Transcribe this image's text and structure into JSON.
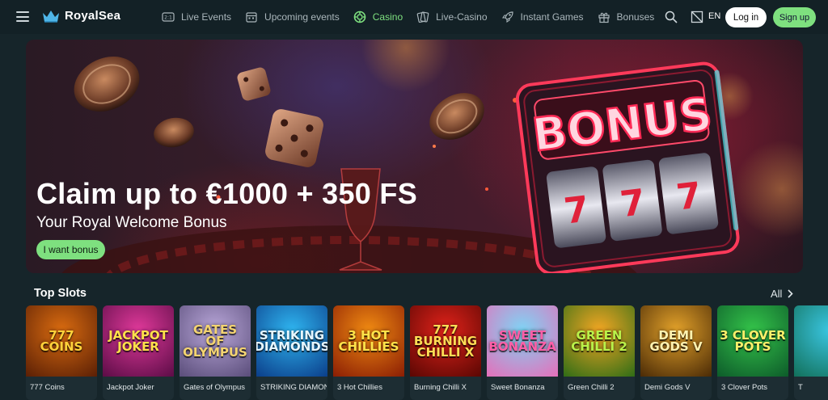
{
  "header": {
    "brand": "RoyalSea",
    "nav": [
      {
        "label": "Live Events",
        "icon": "live-events-icon"
      },
      {
        "label": "Upcoming events",
        "icon": "calendar-icon"
      },
      {
        "label": "Casino",
        "icon": "casino-chip-icon",
        "active": true
      },
      {
        "label": "Live-Casino",
        "icon": "cards-icon"
      },
      {
        "label": "Instant Games",
        "icon": "rocket-icon"
      },
      {
        "label": "Bonuses",
        "icon": "gift-icon"
      }
    ],
    "language": "EN",
    "login_label": "Log in",
    "signup_label": "Sign up",
    "live_events_icon_text": "2:1"
  },
  "banner": {
    "title": "Claim up to €1000 + 350 FS",
    "subtitle": "Your Royal Welcome Bonus",
    "cta_label": "I want bonus",
    "sign_text": "BONUS",
    "reel_symbol": "7"
  },
  "slots_section": {
    "title": "Top Slots",
    "all_label": "All"
  },
  "slots": [
    {
      "name": "777 Coins",
      "art": "777\nCOINS",
      "bg1": "#d96b10",
      "bg2": "#5a1f05",
      "color": "#ffd23a"
    },
    {
      "name": "Jackpot Joker",
      "art": "JACKPOT\nJOKER",
      "bg1": "#e0399a",
      "bg2": "#5b0c46",
      "color": "#ffe14a"
    },
    {
      "name": "Gates of Olympus",
      "art": "GATES OF\nOLYMPUS",
      "bg1": "#b8a6d8",
      "bg2": "#5a4d7a",
      "color": "#f4d470"
    },
    {
      "name": "STRIKING DIAMONDS",
      "art": "STRIKING\nDIAMONDS",
      "bg1": "#2fb5f0",
      "bg2": "#0b3e8a",
      "color": "#e6f6ff"
    },
    {
      "name": "3 Hot Chillies",
      "art": "3 HOT\nCHILLIES",
      "bg1": "#f08a12",
      "bg2": "#8a1d04",
      "color": "#ffe34a"
    },
    {
      "name": "Burning Chilli X",
      "art": "777\nBURNING\nCHILLI X",
      "bg1": "#e0221a",
      "bg2": "#5a0703",
      "color": "#ffdd55"
    },
    {
      "name": "Sweet Bonanza",
      "art": "SWEET\nBONANZA",
      "bg1": "#7fd4f5",
      "bg2": "#e56fb9",
      "color": "#ff5fa8"
    },
    {
      "name": "Green Chilli 2",
      "art": "GREEN\nCHILLI 2",
      "bg1": "#f2a623",
      "bg2": "#2f6d16",
      "color": "#b9f24a"
    },
    {
      "name": "Demi Gods V",
      "art": "DEMI\nGODS V",
      "bg1": "#e3a22a",
      "bg2": "#4a2a06",
      "color": "#fff2b0"
    },
    {
      "name": "3 Clover Pots",
      "art": "3 CLOVER\nPOTS",
      "bg1": "#34c44a",
      "bg2": "#0d5b2a",
      "color": "#fff06a"
    },
    {
      "name": "T",
      "art": "",
      "bg1": "#3ac5e0",
      "bg2": "#12705a",
      "color": "#ffffff"
    }
  ]
}
